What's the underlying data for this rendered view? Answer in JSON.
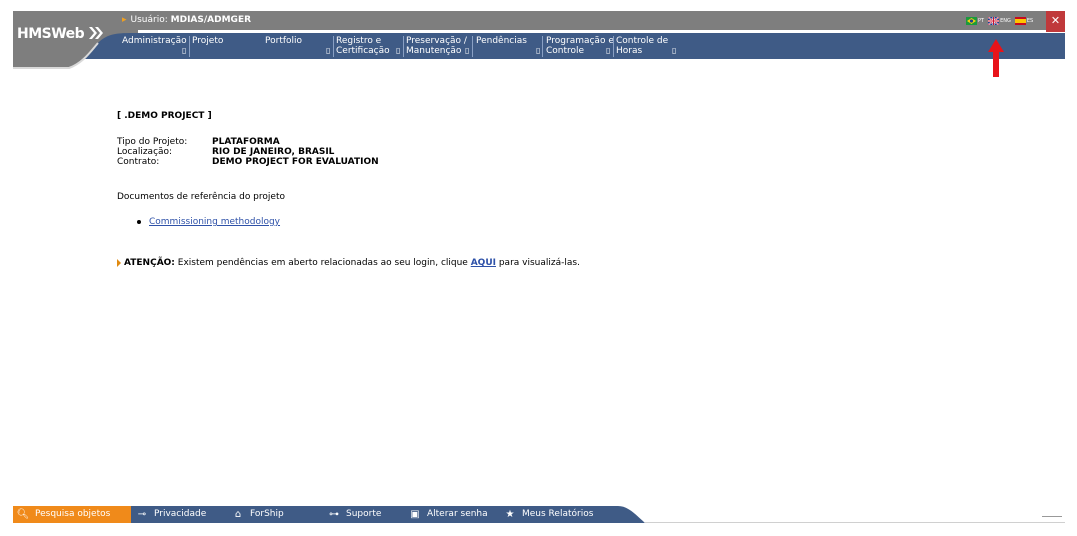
{
  "header": {
    "logo_text": "HMSWeb",
    "user_label": "Usuário:",
    "user_value": "MDIAS/ADMGER",
    "languages": [
      {
        "code": "PT",
        "flag": "brazil-flag-icon"
      },
      {
        "code": "ENG",
        "flag": "uk-flag-icon"
      },
      {
        "code": "ES",
        "flag": "spain-flag-icon"
      }
    ],
    "close_label": "✕",
    "colors": {
      "topbar": "#7e7e7e",
      "menubar": "#3f5b86",
      "close": "#c0393b",
      "accent": "#f08a1a"
    }
  },
  "menu": [
    {
      "line1": "Administração",
      "line2": ""
    },
    {
      "line1": "Projeto",
      "line2": ""
    },
    {
      "line1": "Portfolio",
      "line2": ""
    },
    {
      "line1": "Registro e",
      "line2": "Certificação"
    },
    {
      "line1": "Preservação /",
      "line2": "Manutenção"
    },
    {
      "line1": "Pendências",
      "line2": ""
    },
    {
      "line1": "Programação e",
      "line2": "Controle"
    },
    {
      "line1": "Controle de",
      "line2": "Horas"
    }
  ],
  "menu_mark": "▯",
  "project": {
    "title": "[ .DEMO PROJECT ]",
    "type_label": "Tipo do Projeto:",
    "type_value": "PLATAFORMA",
    "location_label": "Localização:",
    "location_value": "RIO DE JANEIRO, BRASIL",
    "contract_label": "Contrato:",
    "contract_value": "DEMO PROJECT FOR EVALUATION"
  },
  "documents": {
    "heading": "Documentos de referência do projeto",
    "items": [
      "Commissioning methodology"
    ]
  },
  "attention": {
    "label": "ATENÇÃO:",
    "text_before": " Existem pendências em aberto relacionadas ao seu login, clique ",
    "link": "AQUI",
    "text_after": " para visualizá-las."
  },
  "footer": {
    "search": "Pesquisa objetos",
    "privacy": "Privacidade",
    "forship": "ForShip",
    "support": "Suporte",
    "change_password": "Alterar senha",
    "reports": "Meus Relatórios",
    "color": "#3f5b86"
  }
}
